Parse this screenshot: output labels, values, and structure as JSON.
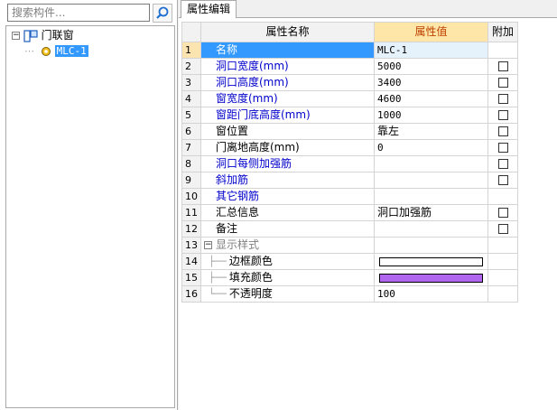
{
  "search": {
    "placeholder": "搜索构件..."
  },
  "tree": {
    "root_label": "门联窗",
    "child_label": "MLC-1",
    "expand_glyph": "−"
  },
  "tab": {
    "label": "属性编辑"
  },
  "table": {
    "headers": {
      "name": "属性名称",
      "value": "属性值",
      "extra": "附加"
    },
    "rows": [
      {
        "num": "1",
        "name": "名称",
        "value": "MLC-1",
        "check": false,
        "style": "selected"
      },
      {
        "num": "2",
        "name": "洞口宽度(mm)",
        "value": "5000",
        "check": true,
        "style": "blue"
      },
      {
        "num": "3",
        "name": "洞口高度(mm)",
        "value": "3400",
        "check": true,
        "style": "blue"
      },
      {
        "num": "4",
        "name": "窗宽度(mm)",
        "value": "4600",
        "check": true,
        "style": "blue"
      },
      {
        "num": "5",
        "name": "窗距门底高度(mm)",
        "value": "1000",
        "check": true,
        "style": "blue"
      },
      {
        "num": "6",
        "name": "窗位置",
        "value": "靠左",
        "check": true,
        "style": "normal"
      },
      {
        "num": "7",
        "name": "门离地高度(mm)",
        "value": "0",
        "check": true,
        "style": "normal"
      },
      {
        "num": "8",
        "name": "洞口每侧加强筋",
        "value": "",
        "check": true,
        "style": "blue"
      },
      {
        "num": "9",
        "name": "斜加筋",
        "value": "",
        "check": true,
        "style": "blue"
      },
      {
        "num": "10",
        "name": "其它钢筋",
        "value": "",
        "check": false,
        "style": "blue"
      },
      {
        "num": "11",
        "name": "汇总信息",
        "value": "洞口加强筋",
        "check": true,
        "style": "normal"
      },
      {
        "num": "12",
        "name": "备注",
        "value": "",
        "check": true,
        "style": "normal"
      },
      {
        "num": "13",
        "name": "显示样式",
        "value": "",
        "check": false,
        "style": "group"
      },
      {
        "num": "14",
        "name": "边框颜色",
        "value": "",
        "check": false,
        "style": "child",
        "swatch": "#ffffff"
      },
      {
        "num": "15",
        "name": "填充颜色",
        "value": "",
        "check": false,
        "style": "child",
        "swatch": "#b066ee"
      },
      {
        "num": "16",
        "name": "不透明度",
        "value": "100",
        "check": false,
        "style": "child-last"
      }
    ]
  },
  "colors": {
    "selection": "#3399ff",
    "header_value_bg": "#fde6a8",
    "header_value_text": "#c04000",
    "link_blue": "#0000cc",
    "fill_purple": "#b066ee"
  }
}
